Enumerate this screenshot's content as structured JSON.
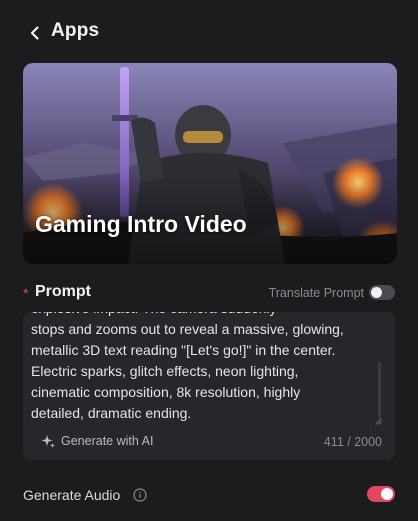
{
  "header": {
    "title": "Apps",
    "back_icon": "chevron-left-icon"
  },
  "hero": {
    "title": "Gaming Intro Video"
  },
  "prompt": {
    "required_mark": "*",
    "label": "Prompt",
    "translate_label": "Translate Prompt",
    "translate_enabled": false,
    "text": "explosive impact. The camera suddenly\nstops and zooms out to reveal a massive, glowing,\nmetallic 3D text reading \"[Let's go!]\" in the center.\nElectric sparks, glitch effects, neon lighting,\ncinematic composition, 8k resolution, highly\ndetailed, dramatic ending.",
    "generate_label": "Generate with AI",
    "generate_icon": "sparkle-icon",
    "char_count": "411 / 2000"
  },
  "audio": {
    "label": "Generate Audio",
    "info_icon": "info-icon",
    "enabled": true
  },
  "colors": {
    "accent": "#e3475f",
    "background": "#1c1c1f",
    "panel": "#27272b"
  }
}
